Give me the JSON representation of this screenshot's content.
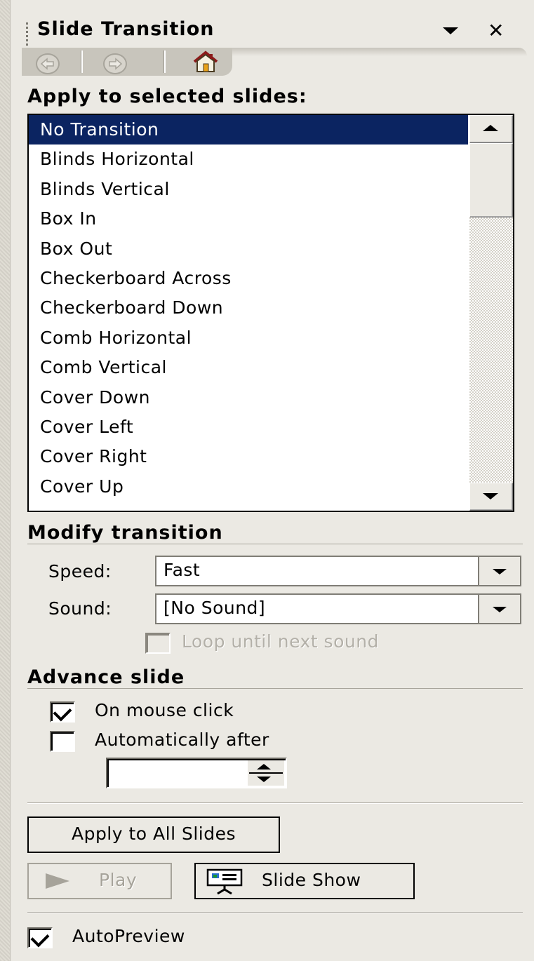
{
  "pane": {
    "title": "Slide Transition",
    "title_dropdown_icon": "dropdown-arrow-icon",
    "close_icon": "close-icon",
    "nav": {
      "back_icon": "back-arrow-icon",
      "forward_icon": "forward-arrow-icon",
      "home_icon": "home-icon"
    }
  },
  "apply_section": {
    "heading": "Apply to selected slides:",
    "items": [
      "No Transition",
      "Blinds Horizontal",
      "Blinds Vertical",
      "Box In",
      "Box Out",
      "Checkerboard Across",
      "Checkerboard Down",
      "Comb Horizontal",
      "Comb Vertical",
      "Cover Down",
      "Cover Left",
      "Cover Right",
      "Cover Up"
    ],
    "selected": "No Transition"
  },
  "modify_section": {
    "heading": "Modify transition",
    "speed_label": "Speed:",
    "speed_value": "Fast",
    "sound_label": "Sound:",
    "sound_value": "[No Sound]",
    "loop_label": "Loop until next sound",
    "loop_checked": false
  },
  "advance_section": {
    "heading": "Advance slide",
    "on_click_label": "On mouse click",
    "on_click_checked": true,
    "auto_label": "Automatically after",
    "auto_checked": false,
    "auto_value": ""
  },
  "actions": {
    "apply_all_label": "Apply to All Slides",
    "play_label": "Play",
    "slideshow_label": "Slide Show",
    "autopreview_label": "AutoPreview",
    "autopreview_checked": true
  },
  "colors": {
    "selection": "#0b2461",
    "pane_bg": "#ebe9e3"
  }
}
